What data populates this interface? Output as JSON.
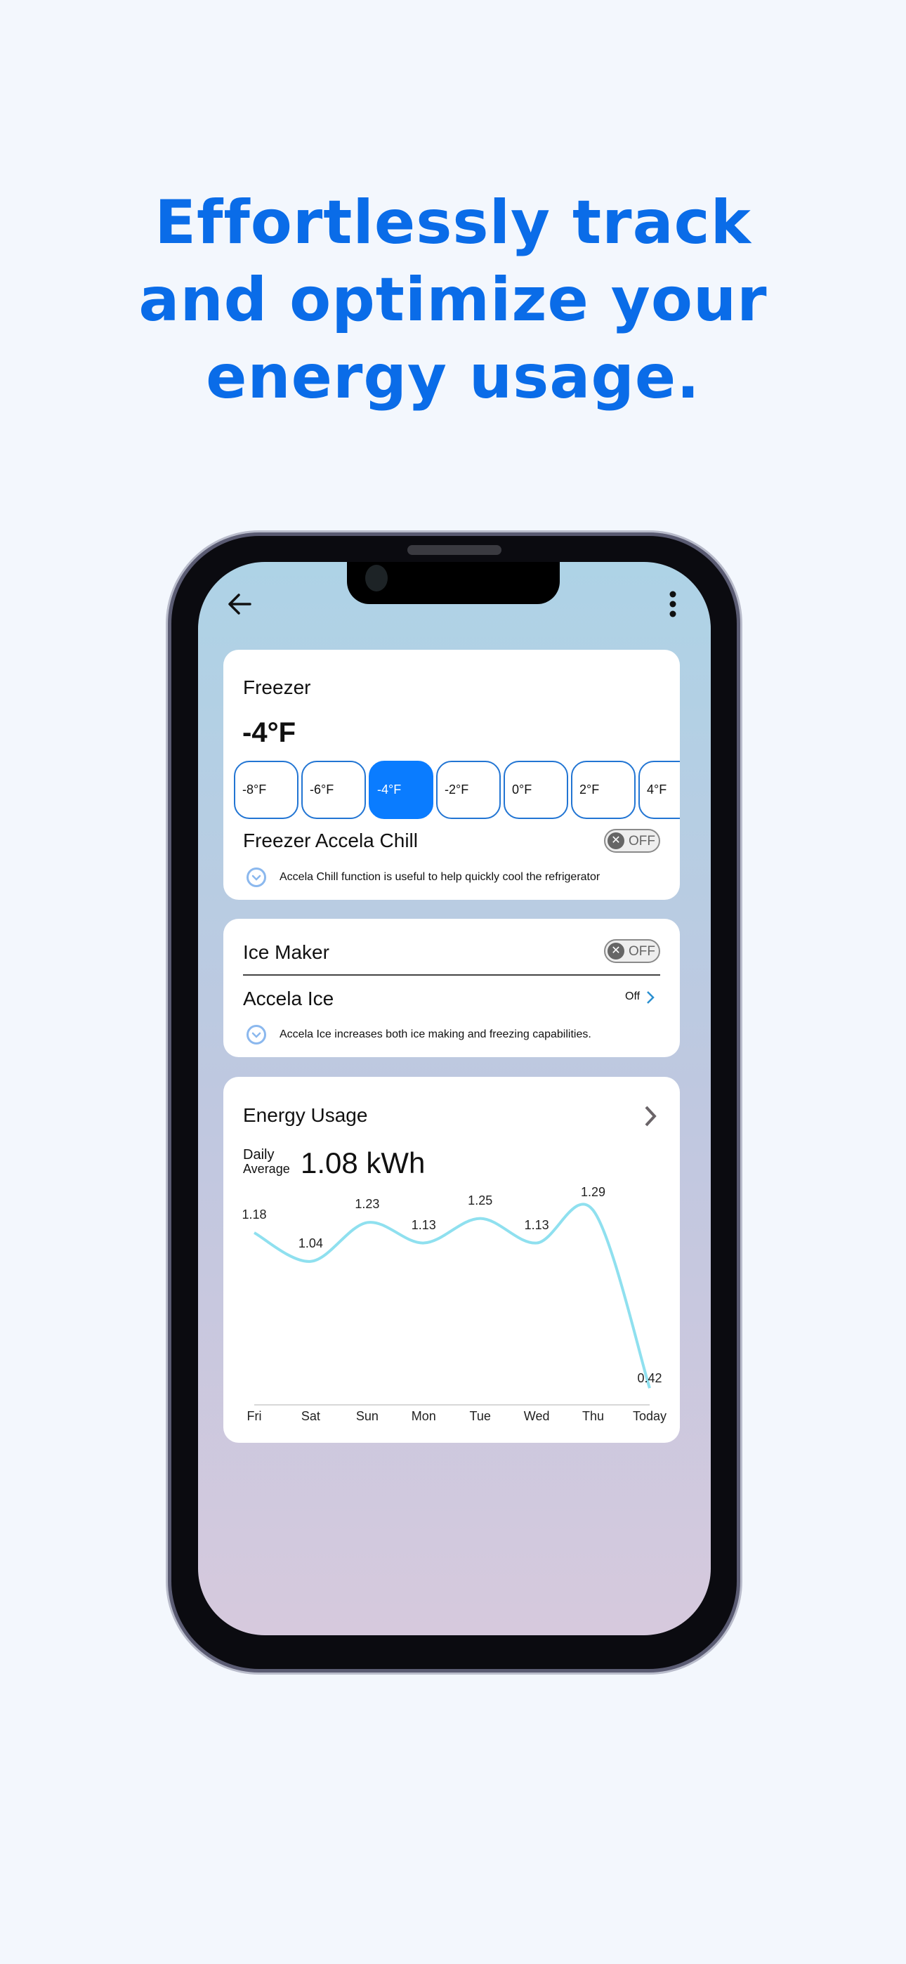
{
  "headline": [
    "Effortlessly track",
    "and optimize your",
    "energy usage."
  ],
  "icons": {
    "back": "arrow-left-icon",
    "menu": "kebab-menu-icon",
    "expand": "chevron-down-circle-icon",
    "forward": "chevron-right-icon",
    "toggle_off": "x-icon"
  },
  "freezer": {
    "title": "Freezer",
    "current_temp": "-4°F",
    "temp_options": [
      "-8°F",
      "-6°F",
      "-4°F",
      "-2°F",
      "0°F",
      "2°F",
      "4°F"
    ],
    "selected_temp": "-4°F",
    "accela_chill_label": "Freezer Accela Chill",
    "accela_chill_toggle": "OFF",
    "accela_chill_hint": "Accela Chill function is useful to help quickly cool the refrigerator"
  },
  "ice": {
    "ice_maker_label": "Ice Maker",
    "ice_maker_toggle": "OFF",
    "accela_ice_label": "Accela Ice",
    "accela_ice_status": "Off",
    "accela_ice_hint": "Accela Ice increases both ice making and freezing capabilities."
  },
  "energy": {
    "title": "Energy Usage",
    "daily_label_1": "Daily",
    "daily_label_2": "Average",
    "daily_value": "1.08 kWh"
  },
  "colors": {
    "accent": "#0a7cff",
    "headline": "#0a6ce8",
    "line": "#8fe0ef"
  },
  "chart_data": {
    "type": "line",
    "categories": [
      "Fri",
      "Sat",
      "Sun",
      "Mon",
      "Tue",
      "Wed",
      "Thu",
      "Today"
    ],
    "values": [
      1.18,
      1.04,
      1.23,
      1.13,
      1.25,
      1.13,
      1.29,
      0.42
    ],
    "labels": [
      "1.18",
      "1.04",
      "1.23",
      "1.13",
      "1.25",
      "1.13",
      "1.29",
      "0.42"
    ],
    "unit": "kWh",
    "grid": false,
    "smooth": true
  }
}
